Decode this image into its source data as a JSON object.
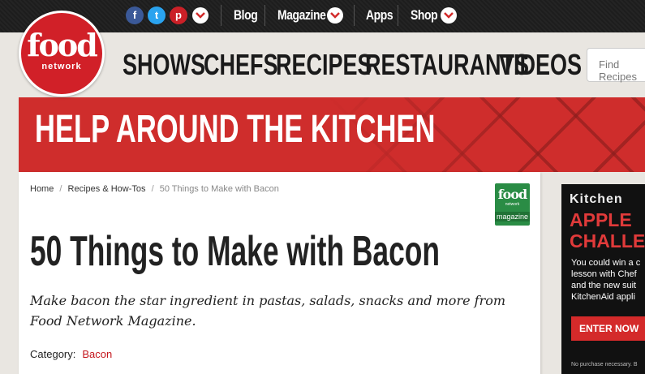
{
  "topbar": {
    "social": [
      {
        "name": "facebook",
        "glyph": "f",
        "color": "#3b5998"
      },
      {
        "name": "twitter",
        "glyph": "t",
        "color": "#2aa3ef"
      },
      {
        "name": "pinterest",
        "glyph": "p",
        "color": "#cb2027"
      }
    ],
    "links": {
      "blog": "Blog",
      "magazine": "Magazine",
      "apps": "Apps",
      "shop": "Shop"
    }
  },
  "logo": {
    "food": "food",
    "network": "network"
  },
  "nav": {
    "shows": "SHOWS",
    "chefs": "CHEFS",
    "recipes": "RECIPES",
    "restaurants": "RESTAURANTS",
    "videos": "VIDEOS"
  },
  "search": {
    "placeholder": "Find Recipes"
  },
  "banner": {
    "title": "HELP AROUND THE KITCHEN"
  },
  "breadcrumb": {
    "home": "Home",
    "section": "Recipes & How-Tos",
    "current": "50 Things to Make with Bacon",
    "separator": "/"
  },
  "magazine_badge": {
    "food": "food",
    "network": "network",
    "magazine": "magazine"
  },
  "article": {
    "title": "50 Things to Make with Bacon",
    "description": "Make bacon the star ingredient in pastas, salads, snacks and more from Food Network Magazine.",
    "category_label": "Category:",
    "category_value": "Bacon"
  },
  "ad": {
    "line1": "Kitchen",
    "line2": "APPLE",
    "line3": "CHALLE",
    "copy": [
      "You could win a c",
      "lesson with Chef",
      "and the new suit",
      "KitchenAid appli"
    ],
    "cta": "ENTER NOW",
    "fine_print": "No purchase necessary. B"
  },
  "colors": {
    "brand_red": "#d12028",
    "banner_red": "#cf2d2c",
    "link_red": "#c4161c",
    "topbar": "#1d1d1d"
  }
}
